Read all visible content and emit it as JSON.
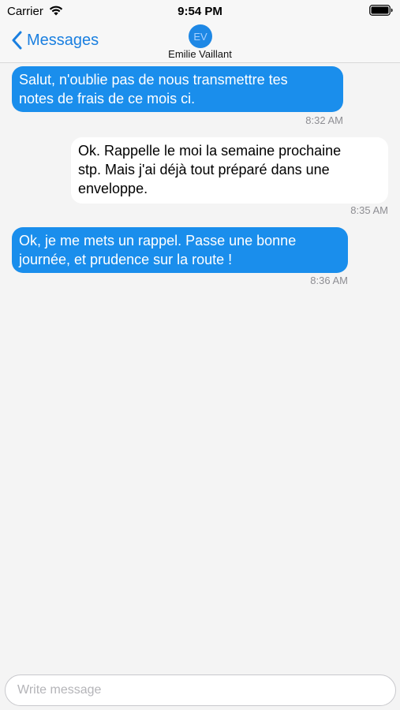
{
  "status_bar": {
    "carrier": "Carrier",
    "time": "9:54 PM",
    "icons": [
      "wifi-icon",
      "battery-icon"
    ]
  },
  "nav": {
    "back_label": "Messages",
    "back_icon": "chevron-left-icon",
    "avatar_initials": "EV",
    "contact_name": "Emilie Vaillant"
  },
  "colors": {
    "accent": "#1a7fe0",
    "outgoing_bubble": "#1a8eec",
    "incoming_bubble": "#ffffff",
    "background": "#f4f4f4"
  },
  "messages": [
    {
      "direction": "outgoing",
      "lines": [
        "Salut, n'oublie pas de nous transmettre tes",
        "notes de frais de ce mois ci."
      ],
      "time": "8:32 AM"
    },
    {
      "direction": "incoming",
      "lines": [
        "Ok. Rappelle le moi la semaine prochaine",
        "stp. Mais j'ai déjà tout préparé dans une",
        "enveloppe."
      ],
      "time": "8:35 AM"
    },
    {
      "direction": "outgoing",
      "lines": [
        "Ok, je me mets un rappel. Passe une bonne",
        "journée, et prudence sur la route !"
      ],
      "time": "8:36 AM"
    }
  ],
  "composer": {
    "placeholder": "Write message",
    "value": ""
  }
}
